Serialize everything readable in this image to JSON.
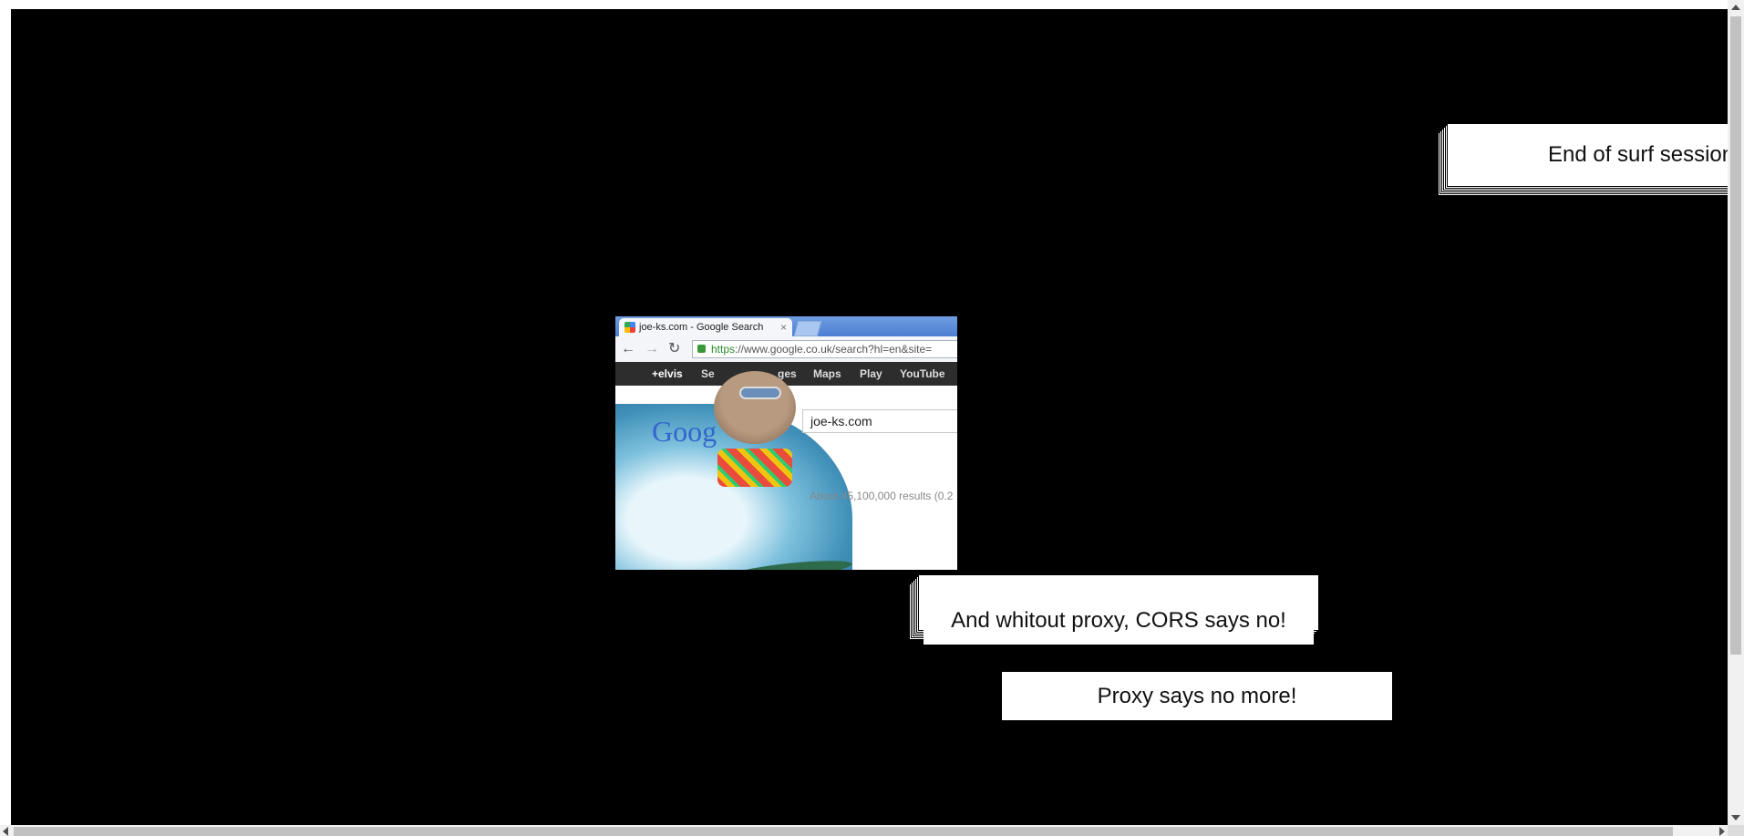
{
  "slides": {
    "end_session": "End of surf session",
    "cors_no": "And whitout proxy, CORS says no!",
    "proxy_no_more": "Proxy says no more!"
  },
  "browser_image": {
    "tab_title": "joe-ks.com - Google Search",
    "tab_close": "×",
    "url_https": "https",
    "url_rest": "://www.google.co.uk/search?hl=en&site=",
    "nav_items": [
      "+elvis",
      "Se",
      "ges",
      "Maps",
      "Play",
      "YouTube"
    ],
    "logo_fragment": "Goog",
    "search_value": "joe-ks.com",
    "results_text": "About 45,100,000 results (0.2"
  },
  "colors": {
    "stage_background": "#000000",
    "card_background": "#ffffff"
  }
}
